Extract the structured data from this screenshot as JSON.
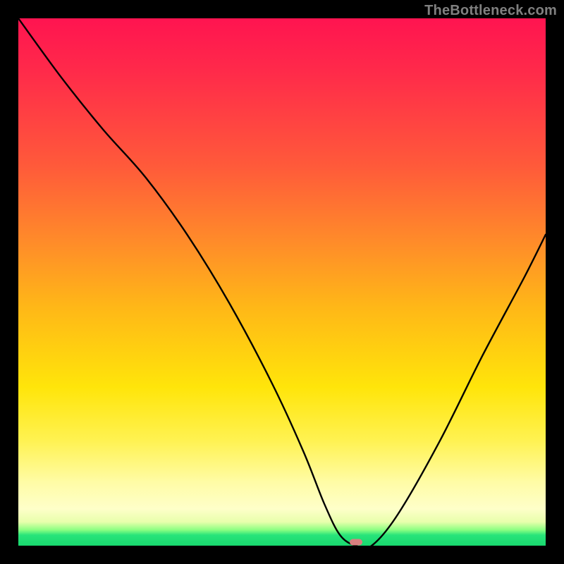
{
  "watermark": "TheBottleneck.com",
  "marker": {
    "x_percent": 64,
    "y_percent": 99.3
  },
  "colors": {
    "frame": "#000000",
    "curve": "#000000",
    "marker": "#d98080",
    "watermark": "#808080",
    "gradient_stops": [
      {
        "pct": 0,
        "color": "#ff1450"
      },
      {
        "pct": 10,
        "color": "#ff2a4a"
      },
      {
        "pct": 28,
        "color": "#ff5a3a"
      },
      {
        "pct": 42,
        "color": "#ff8a2a"
      },
      {
        "pct": 55,
        "color": "#ffb817"
      },
      {
        "pct": 70,
        "color": "#ffe50a"
      },
      {
        "pct": 80,
        "color": "#fff251"
      },
      {
        "pct": 88,
        "color": "#fffca6"
      },
      {
        "pct": 93,
        "color": "#feffc9"
      },
      {
        "pct": 95.5,
        "color": "#e8ffac"
      },
      {
        "pct": 97,
        "color": "#8cff82"
      },
      {
        "pct": 98,
        "color": "#28e47a"
      },
      {
        "pct": 100,
        "color": "#18d86e"
      }
    ]
  },
  "chart_data": {
    "type": "line",
    "title": "",
    "xlabel": "",
    "ylabel": "",
    "xlim": [
      0,
      100
    ],
    "ylim": [
      0,
      100
    ],
    "series": [
      {
        "name": "bottleneck-curve",
        "x": [
          0,
          8,
          16,
          24,
          32,
          40,
          48,
          54,
          58,
          61,
          64,
          67,
          72,
          80,
          88,
          96,
          100
        ],
        "y": [
          100,
          89,
          79,
          70,
          59,
          46,
          31,
          18,
          8,
          2,
          0,
          0,
          6,
          20,
          36,
          51,
          59
        ]
      }
    ],
    "annotations": [
      {
        "type": "marker",
        "x": 64,
        "y": 0,
        "label": "optimal-point"
      }
    ],
    "note": "x and y are in percent of plotting-area width/height; y=0 is the bottom (green) edge, y=100 is the top (red) edge."
  }
}
